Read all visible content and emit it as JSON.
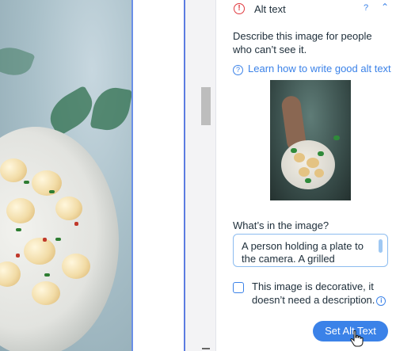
{
  "panel": {
    "section_title": "Alt text",
    "help_mark": "?",
    "collapse_icon": "chevron-up",
    "description": "Describe this image for people who can’t see it.",
    "learn_link": "Learn how to write good alt text",
    "question_label": "What’s in the image?",
    "alt_text_value": "A person holding a plate to the camera. A grilled cauliflower salad is on the plate.",
    "decorative_label": "This image is decorative, it doesn’t need a description.",
    "decorative_checked": false,
    "set_button": "Set Alt Text"
  },
  "colors": {
    "accent": "#3b82e8",
    "alert": "#e0393e",
    "text": "#20303c",
    "selection_border": "#5b7be0"
  }
}
